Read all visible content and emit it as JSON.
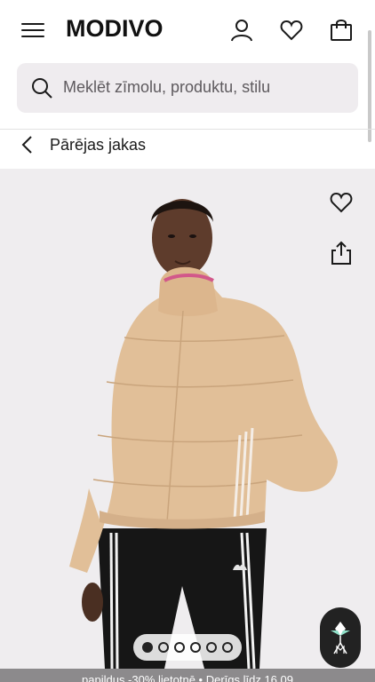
{
  "header": {
    "logo": "MODIVO",
    "icons": [
      "menu-icon",
      "user-icon",
      "heart-icon",
      "bag-icon"
    ]
  },
  "search": {
    "placeholder": "Meklēt zīmolu, produktu, stilu"
  },
  "breadcrumb": {
    "back_label": "Pārējas jakas"
  },
  "product": {
    "image_count": 6,
    "active_image": 1,
    "actions": [
      "wishlist-heart-icon",
      "share-icon"
    ]
  },
  "promo": {
    "text": "papildus -30% lietotnē • Derīgs līdz 16.09"
  },
  "colors": {
    "accent": "#1a1a1a",
    "search_bg": "#efecef",
    "product_bg": "#efedef",
    "promo_bg": "#8c8a8c"
  }
}
